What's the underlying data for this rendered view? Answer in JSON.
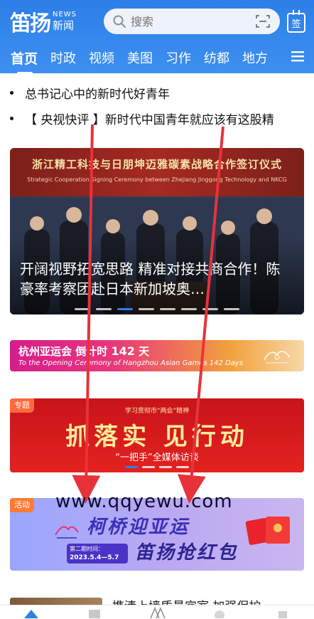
{
  "app": {
    "logo_main": "笛扬",
    "logo_en": "NEWS",
    "logo_cn": "新闻",
    "sign_label": "签"
  },
  "search": {
    "placeholder": "搜索"
  },
  "tabs": [
    {
      "label": "首页",
      "active": true
    },
    {
      "label": "时政"
    },
    {
      "label": "视频"
    },
    {
      "label": "美图"
    },
    {
      "label": "习作"
    },
    {
      "label": "纺都"
    },
    {
      "label": "地方"
    }
  ],
  "headlines": [
    "总书记心中的新时代好青年",
    "【 央视快评 】新时代中国青年就应该有这股精"
  ],
  "hero": {
    "banner_cn": "浙江精工科技与日朋坤迈雅碳素战略合作签订仪式",
    "banner_en": "Strategic Cooperation Signing Ceremony between Zhejiang Jinggong Technology and NKCG",
    "caption": "开阔视野拓宽思路 精准对接共商合作！陈豪率考察团赴日本新加坡奥…"
  },
  "asian_games": {
    "countdown_prefix": "杭州亚运会",
    "countdown_mid": "倒计时",
    "days": "142",
    "days_unit": "天",
    "english": "To the Opening Ceremony of Hangzhou Asian Games 142 Days"
  },
  "topic": {
    "tag": "专题",
    "sub": "学习贯彻市“两会”精神",
    "big": "抓落实 见行动",
    "line": "“一把手”全媒体访谈"
  },
  "activity": {
    "tag": "活动",
    "title_1": "柯桥迎亚运",
    "title_2": "笛扬抢红包",
    "time_label": "第二期时间：",
    "time_value": "2023.5.4—5.7"
  },
  "watermark": "www.qqyewu.com",
  "next_item": {
    "title": "携清上墙质最宜室 加强保护"
  },
  "colors": {
    "header_blue": "#2c7fe8",
    "arrow_red": "#e8323a",
    "topic_red": "#d71b1f"
  }
}
